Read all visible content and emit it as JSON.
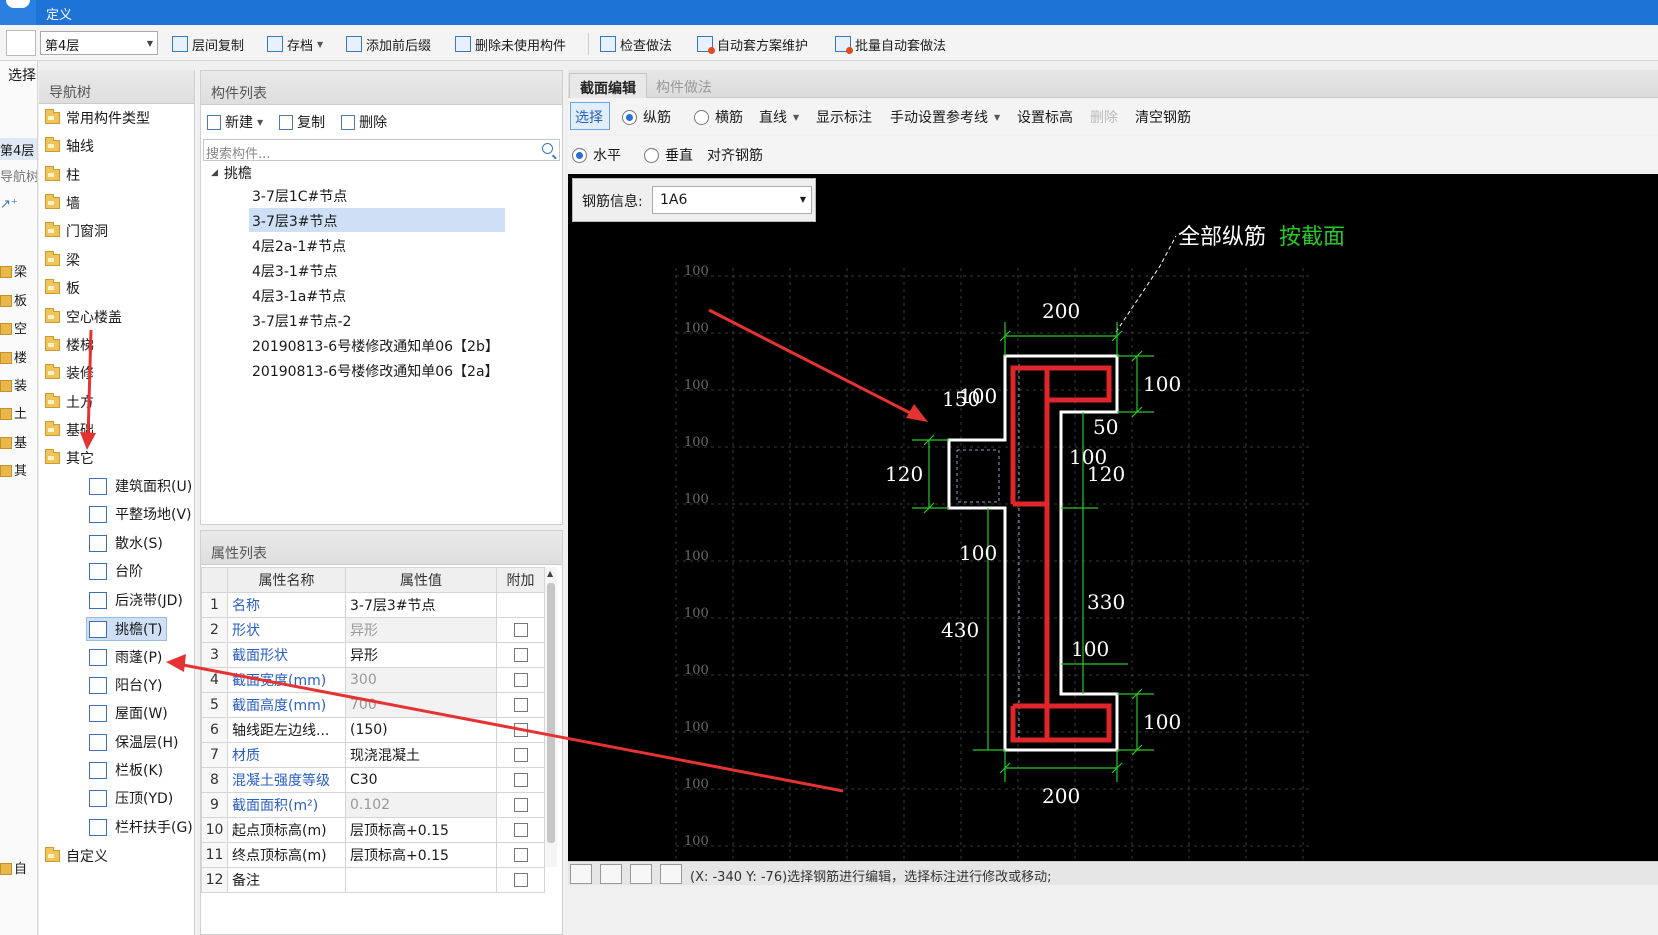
{
  "titlebar": {
    "title": "定义"
  },
  "toolbar": {
    "floor": "第4层",
    "items": [
      {
        "label": "层间复制"
      },
      {
        "label": "存档"
      },
      {
        "label": "添加前后缀"
      },
      {
        "label": "删除未使用构件"
      },
      {
        "label": "检查做法"
      },
      {
        "label": "自动套方案维护"
      },
      {
        "label": "批量自动套做法"
      }
    ]
  },
  "leftstrip": {
    "select_label": "选择",
    "floor_label": "第4层",
    "nav_label": "导航树",
    "items": [
      "梁",
      "板",
      "空",
      "楼",
      "装",
      "土",
      "基",
      "其",
      "自"
    ]
  },
  "nav": {
    "header": "导航树",
    "folders": [
      "常用构件类型",
      "轴线",
      "柱",
      "墙",
      "门窗洞",
      "梁",
      "板",
      "空心楼盖",
      "楼梯",
      "装修",
      "土方",
      "基础",
      "其它"
    ],
    "sub_items": [
      "建筑面积(U)",
      "平整场地(V)",
      "散水(S)",
      "台阶",
      "后浇带(JD)",
      "挑檐(T)",
      "雨蓬(P)",
      "阳台(Y)",
      "屋面(W)",
      "保温层(H)",
      "栏板(K)",
      "压顶(YD)",
      "栏杆扶手(G)"
    ],
    "custom": "自定义"
  },
  "components": {
    "header": "构件列表",
    "new_label": "新建",
    "copy_label": "复制",
    "delete_label": "删除",
    "search_placeholder": "搜索构件...",
    "root": "挑檐",
    "items": [
      "3-7层1C#节点",
      "3-7层3#节点",
      "4层2a-1#节点",
      "4层3-1#节点",
      "4层3-1a#节点",
      "3-7层1#节点-2",
      "20190813-6号楼修改通知单06【2b】",
      "20190813-6号楼修改通知单06【2a】"
    ],
    "selected_index": 1
  },
  "properties": {
    "header": "属性列表",
    "columns": [
      "属性名称",
      "属性值",
      "附加"
    ],
    "rows": [
      {
        "n": "1",
        "name": "名称",
        "value": "3-7层3#节点",
        "blue": true,
        "gray": false,
        "check": false
      },
      {
        "n": "2",
        "name": "形状",
        "value": "异形",
        "blue": true,
        "gray": true,
        "check": true
      },
      {
        "n": "3",
        "name": "截面形状",
        "value": "异形",
        "blue": true,
        "gray": false,
        "check": true
      },
      {
        "n": "4",
        "name": "截面宽度(mm)",
        "value": "300",
        "blue": true,
        "gray": true,
        "check": true
      },
      {
        "n": "5",
        "name": "截面高度(mm)",
        "value": "700",
        "blue": true,
        "gray": true,
        "check": true
      },
      {
        "n": "6",
        "name": "轴线距左边线...",
        "value": "(150)",
        "blue": false,
        "gray": false,
        "check": true
      },
      {
        "n": "7",
        "name": "材质",
        "value": "现浇混凝土",
        "blue": true,
        "gray": false,
        "check": true
      },
      {
        "n": "8",
        "name": "混凝土强度等级",
        "value": "C30",
        "blue": true,
        "gray": false,
        "check": true
      },
      {
        "n": "9",
        "name": "截面面积(m²)",
        "value": "0.102",
        "blue": true,
        "gray": true,
        "check": true
      },
      {
        "n": "10",
        "name": "起点顶标高(m)",
        "value": "层顶标高+0.15",
        "blue": false,
        "gray": false,
        "check": true
      },
      {
        "n": "11",
        "name": "终点顶标高(m)",
        "value": "层顶标高+0.15",
        "blue": false,
        "gray": false,
        "check": true
      },
      {
        "n": "12",
        "name": "备注",
        "value": "",
        "blue": false,
        "gray": false,
        "check": true
      }
    ]
  },
  "editor": {
    "tabs": [
      "截面编辑",
      "构件做法"
    ],
    "select_label": "选择",
    "long_rebar": "纵筋",
    "stirrup": "横筋",
    "line_label": "直线",
    "show_dims": "显示标注",
    "ref_line": "手动设置参考线",
    "set_elev": "设置标高",
    "delete_label": "删除",
    "clear_rebar": "清空钢筋",
    "horizontal": "水平",
    "vertical": "垂直",
    "align_rebar": "对齐钢筋",
    "rebar_info_label": "钢筋信息:",
    "rebar_info_value": "1A6",
    "note_white": "全部纵筋",
    "note_green": "按截面",
    "grid_label": "100",
    "dims": {
      "top": "200",
      "right_top": "100",
      "d150": "150",
      "d100a": "100",
      "d50": "50",
      "d120l": "120",
      "d100b": "100",
      "d120r": "120",
      "d100c": "100",
      "d330": "330",
      "d430": "430",
      "d100d": "100",
      "right_bottom": "100",
      "bottom": "200"
    },
    "status": "(X: -340 Y: -76)选择钢筋进行编辑，选择标注进行修改或移动;"
  },
  "colors": {
    "accent": "#1e73d6",
    "dim_green": "#29c829",
    "rebar_red": "#e0262a",
    "arrow_red": "#e53232"
  }
}
